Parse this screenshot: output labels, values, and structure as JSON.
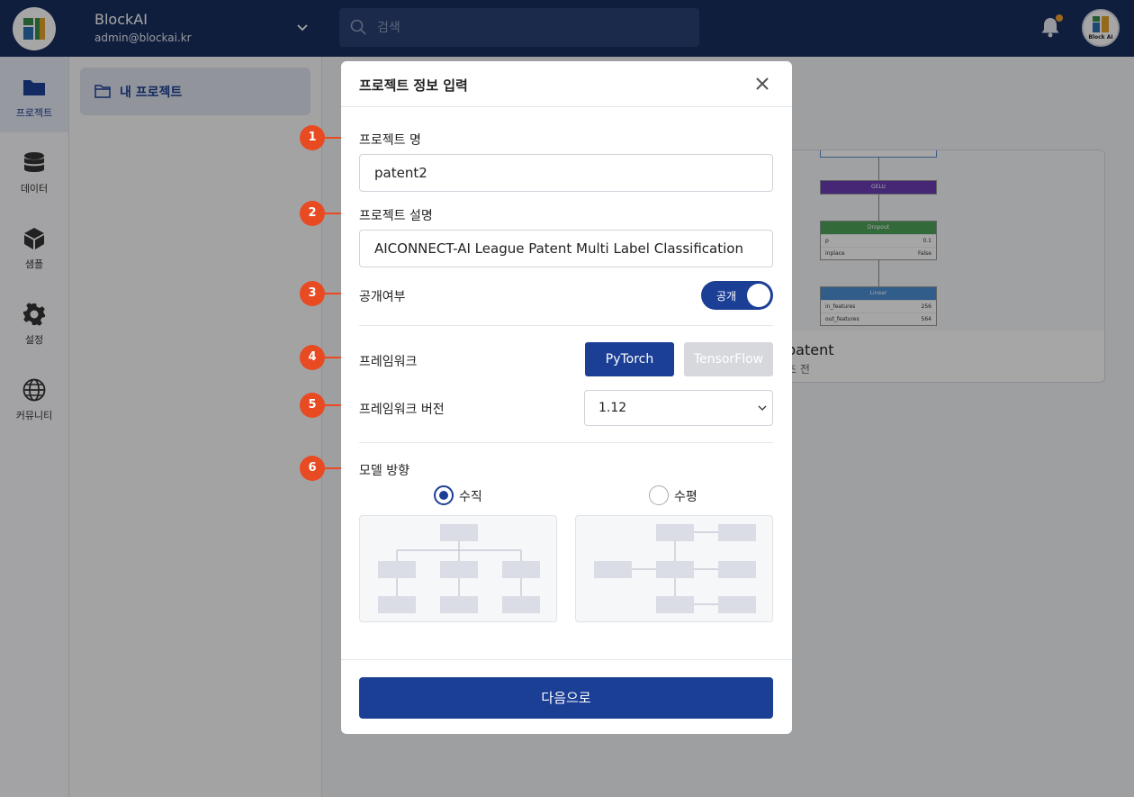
{
  "app": {
    "name": "BlockAI",
    "email": "admin@blockai.kr",
    "avatar_text": "Block AI"
  },
  "search": {
    "placeholder": "검색"
  },
  "rail": [
    {
      "label": "프로젝트",
      "icon": "folder-icon",
      "active": true
    },
    {
      "label": "데이터",
      "icon": "database-icon",
      "active": false
    },
    {
      "label": "샘플",
      "icon": "cube-icon",
      "active": false
    },
    {
      "label": "설정",
      "icon": "gear-icon",
      "active": false
    },
    {
      "label": "커뮤니티",
      "icon": "globe-icon",
      "active": false
    }
  ],
  "subnav": {
    "label": "내 프로젝트"
  },
  "project_card": {
    "name": "patent",
    "time": "초 전",
    "nodes": [
      {
        "title": "GELU"
      },
      {
        "title": "Dropout",
        "rows": [
          [
            "p",
            "0.1"
          ],
          [
            "inplace",
            "False"
          ]
        ]
      },
      {
        "title": "Linear",
        "rows": [
          [
            "in_features",
            "256"
          ],
          [
            "out_features",
            "564"
          ]
        ]
      }
    ]
  },
  "modal": {
    "title": "프로젝트 정보 입력",
    "project_name_label": "프로젝트 명",
    "project_name_value": "patent2",
    "project_desc_label": "프로젝트 설명",
    "project_desc_value": "AICONNECT-AI League Patent Multi Label Classification",
    "public_label": "공개여부",
    "public_toggle_label": "공개",
    "public_toggle_on": true,
    "framework_label": "프레임워크",
    "framework_options": [
      "PyTorch",
      "TensorFlow"
    ],
    "framework_selected": "PyTorch",
    "framework_version_label": "프레임워크 버전",
    "framework_version_value": "1.12",
    "direction_label": "모델 방향",
    "direction_options": [
      "수직",
      "수평"
    ],
    "direction_selected": "수직",
    "next_label": "다음으로"
  },
  "steps": [
    "1",
    "2",
    "3",
    "4",
    "5",
    "6"
  ],
  "colors": {
    "topbar": "#1a2e5e",
    "primary": "#1c3f96",
    "step_marker": "#e84a21",
    "notification_dot": "#f0a030"
  }
}
